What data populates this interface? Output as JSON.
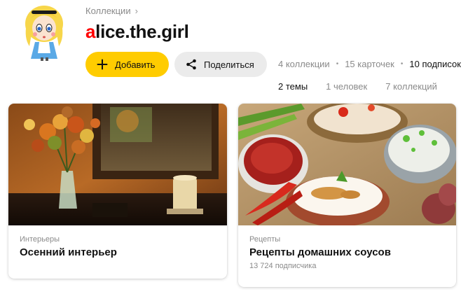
{
  "breadcrumb": {
    "label": "Коллекции",
    "chevron": "chevron-right-icon"
  },
  "profile": {
    "name_first_letter": "a",
    "name_rest": "lice.the.girl",
    "accent": "#ff0000"
  },
  "actions": {
    "add_label": "Добавить",
    "add_icon": "plus-icon",
    "add_color": "#ffcc00",
    "share_label": "Поделиться",
    "share_icon": "share-icon",
    "share_color": "#ebebeb"
  },
  "stats": {
    "collections": "4 коллекции",
    "cards": "15 карточек",
    "subscriptions": "10 подписок"
  },
  "subscriptions": {
    "themes": "2 темы",
    "people": "1 человек",
    "collections": "7 коллекций"
  },
  "cards": [
    {
      "category": "Интерьеры",
      "title": "Осенний интерьер",
      "image": "autumn-interior-photo"
    },
    {
      "category": "Рецепты",
      "title": "Рецепты домашних соусов",
      "subscribers": "13 724 подписчика",
      "image": "sauces-photo"
    }
  ]
}
